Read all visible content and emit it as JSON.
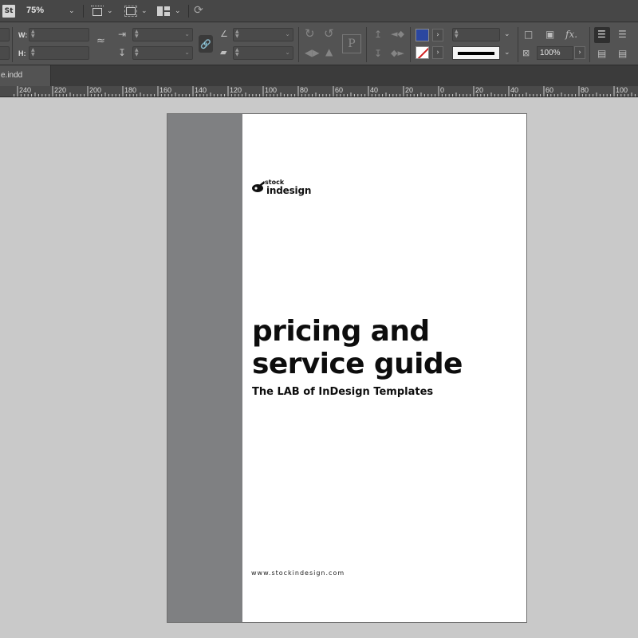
{
  "app": {
    "logo": "St",
    "zoom": "75%",
    "icons": [
      "view-options-icon",
      "screen-mode-icon",
      "arrange-documents-icon",
      "publish-online-icon"
    ]
  },
  "control_panel": {
    "width_label": "W:",
    "height_label": "H:",
    "opacity_value": "100%",
    "fill_color": "#2b47a0",
    "stroke_color": "none"
  },
  "document": {
    "tab_label": "e.indd"
  },
  "ruler": {
    "ticks": [
      "240",
      "220",
      "200",
      "180",
      "160",
      "140",
      "120",
      "100",
      "80",
      "60",
      "40",
      "20",
      "0",
      "20",
      "40",
      "60",
      "80",
      "100"
    ]
  },
  "page": {
    "band_color": "#7f8082",
    "brand_top": ".stock",
    "brand_bottom": "indesign",
    "title_line1": "pricing and",
    "title_line2": "service guide",
    "subtitle": "The LAB of InDesign Templates",
    "website": "www.stockindesign.com"
  }
}
